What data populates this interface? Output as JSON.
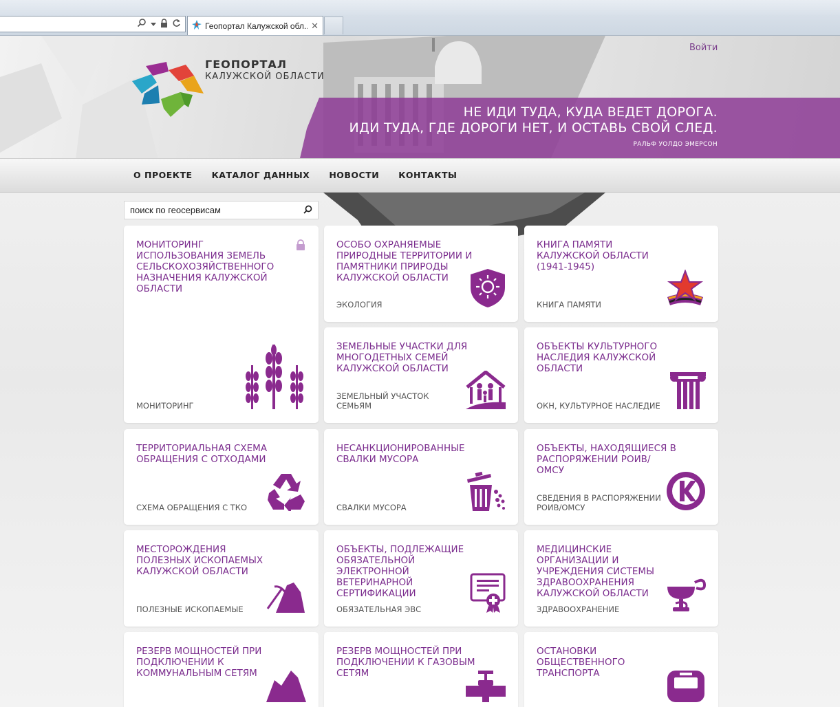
{
  "browser": {
    "tab_title": "Геопортал Калужской обл...",
    "close_glyph": "✕"
  },
  "header": {
    "brand_line1": "ГЕОПОРТАЛ",
    "brand_line2": "КАЛУЖСКОЙ ОБЛАСТИ",
    "login": "Войти",
    "quote_line1": "НЕ ИДИ ТУДА, КУДА ВЕДЕТ ДОРОГА.",
    "quote_line2": "ИДИ ТУДА, ГДЕ ДОРОГИ НЕТ, И ОСТАВЬ СВОЙ СЛЕД.",
    "quote_author": "РАЛЬФ УОЛДО ЭМЕРСОН"
  },
  "nav": {
    "items": [
      {
        "label": "О ПРОЕКТЕ"
      },
      {
        "label": "КАТАЛОГ ДАННЫХ"
      },
      {
        "label": "НОВОСТИ"
      },
      {
        "label": "КОНТАКТЫ"
      }
    ]
  },
  "search": {
    "placeholder": "поиск по геосервисам"
  },
  "colors": {
    "accent": "#7b2d8e",
    "icon": "#8a2a8e"
  },
  "cards": [
    {
      "title": "МОНИТОРИНГ ИСПОЛЬЗОВАНИЯ ЗЕМЕЛЬ СЕЛЬСКОХОЗЯЙСТВЕННОГО НАЗНАЧЕНИЯ КАЛУЖСКОЙ ОБЛАСТИ",
      "subtitle": "МОНИТОРИНГ",
      "icon": "wheat-icon",
      "locked": true
    },
    {
      "title": "ОСОБО ОХРАНЯЕМЫЕ ПРИРОДНЫЕ ТЕРРИТОРИИ И ПАМЯТНИКИ ПРИРОДЫ КАЛУЖСКОЙ ОБЛАСТИ",
      "subtitle": "ЭКОЛОГИЯ",
      "icon": "shield-sun-icon"
    },
    {
      "title": "КНИГА ПАМЯТИ КАЛУЖСКОЙ ОБЛАСТИ (1941-1945)",
      "subtitle": "КНИГА ПАМЯТИ",
      "icon": "red-star-ribbon-icon"
    },
    {
      "title": "ЗЕМЕЛЬНЫЕ УЧАСТКИ ДЛЯ МНОГОДЕТНЫХ СЕМЕЙ КАЛУЖСКОЙ ОБЛАСТИ",
      "subtitle": "ЗЕМЕЛЬНЫЙ УЧАСТОК СЕМЬЯМ",
      "icon": "family-house-icon"
    },
    {
      "title": "ОБЪЕКТЫ КУЛЬТУРНОГО НАСЛЕДИЯ КАЛУЖСКОЙ ОБЛАСТИ",
      "subtitle": "ОКН, КУЛЬТУРНОЕ НАСЛЕДИЕ",
      "icon": "column-icon"
    },
    {
      "title": "ТЕРРИТОРИАЛЬНАЯ СХЕМА ОБРАЩЕНИЯ С ОТХОДАМИ",
      "subtitle": "СХЕМА ОБРАЩЕНИЯ С ТКО",
      "icon": "recycle-icon"
    },
    {
      "title": "НЕСАНКЦИОНИРОВАННЫЕ СВАЛКИ МУСОРА",
      "subtitle": "СВАЛКИ МУСОРА",
      "icon": "trash-bin-icon"
    },
    {
      "title": "ОБЪЕКТЫ, НАХОДЯЩИЕСЯ В РАСПОРЯЖЕНИИ РОИВ/ОМСУ",
      "subtitle": "СВЕДЕНИЯ В РАСПОРЯЖЕНИИ РОИВ/ОМСУ",
      "icon": "letter-k-icon"
    },
    {
      "title": "МЕСТОРОЖДЕНИЯ ПОЛЕЗНЫХ ИСКОПАЕМЫХ КАЛУЖСКОЙ ОБЛАСТИ",
      "subtitle": "ПОЛЕЗНЫЕ ИСКОПАЕМЫЕ",
      "icon": "pickaxe-mountain-icon"
    },
    {
      "title": "ОБЪЕКТЫ, ПОДЛЕЖАЩИЕ ОБЯЗАТЕЛЬНОЙ ЭЛЕКТРОННОЙ ВЕТЕРИНАРНОЙ СЕРТИФИКАЦИИ",
      "subtitle": "ОБЯЗАТЕЛЬНАЯ ЭВС",
      "icon": "certificate-icon"
    },
    {
      "title": "МЕДИЦИНСКИЕ ОРГАНИЗАЦИИ И УЧРЕЖДЕНИЯ СИСТЕМЫ ЗДРАВООХРАНЕНИЯ КАЛУЖСКОЙ ОБЛАСТИ",
      "subtitle": "ЗДРАВООХРАНЕНИЕ",
      "icon": "medical-bowl-icon"
    },
    {
      "title": "РЕЗЕРВ МОЩНОСТЕЙ ПРИ ПОДКЛЮЧЕНИИ К КОММУНАЛЬНЫМ СЕТЯМ",
      "subtitle": "",
      "icon": "mountain-icon"
    },
    {
      "title": "РЕЗЕРВ МОЩНОСТЕЙ ПРИ ПОДКЛЮЧЕНИИ К ГАЗОВЫМ СЕТЯМ",
      "subtitle": "",
      "icon": "gas-valve-icon"
    },
    {
      "title": "ОСТАНОВКИ ОБЩЕСТВЕННОГО ТРАНСПОРТА",
      "subtitle": "",
      "icon": "bus-icon"
    }
  ]
}
